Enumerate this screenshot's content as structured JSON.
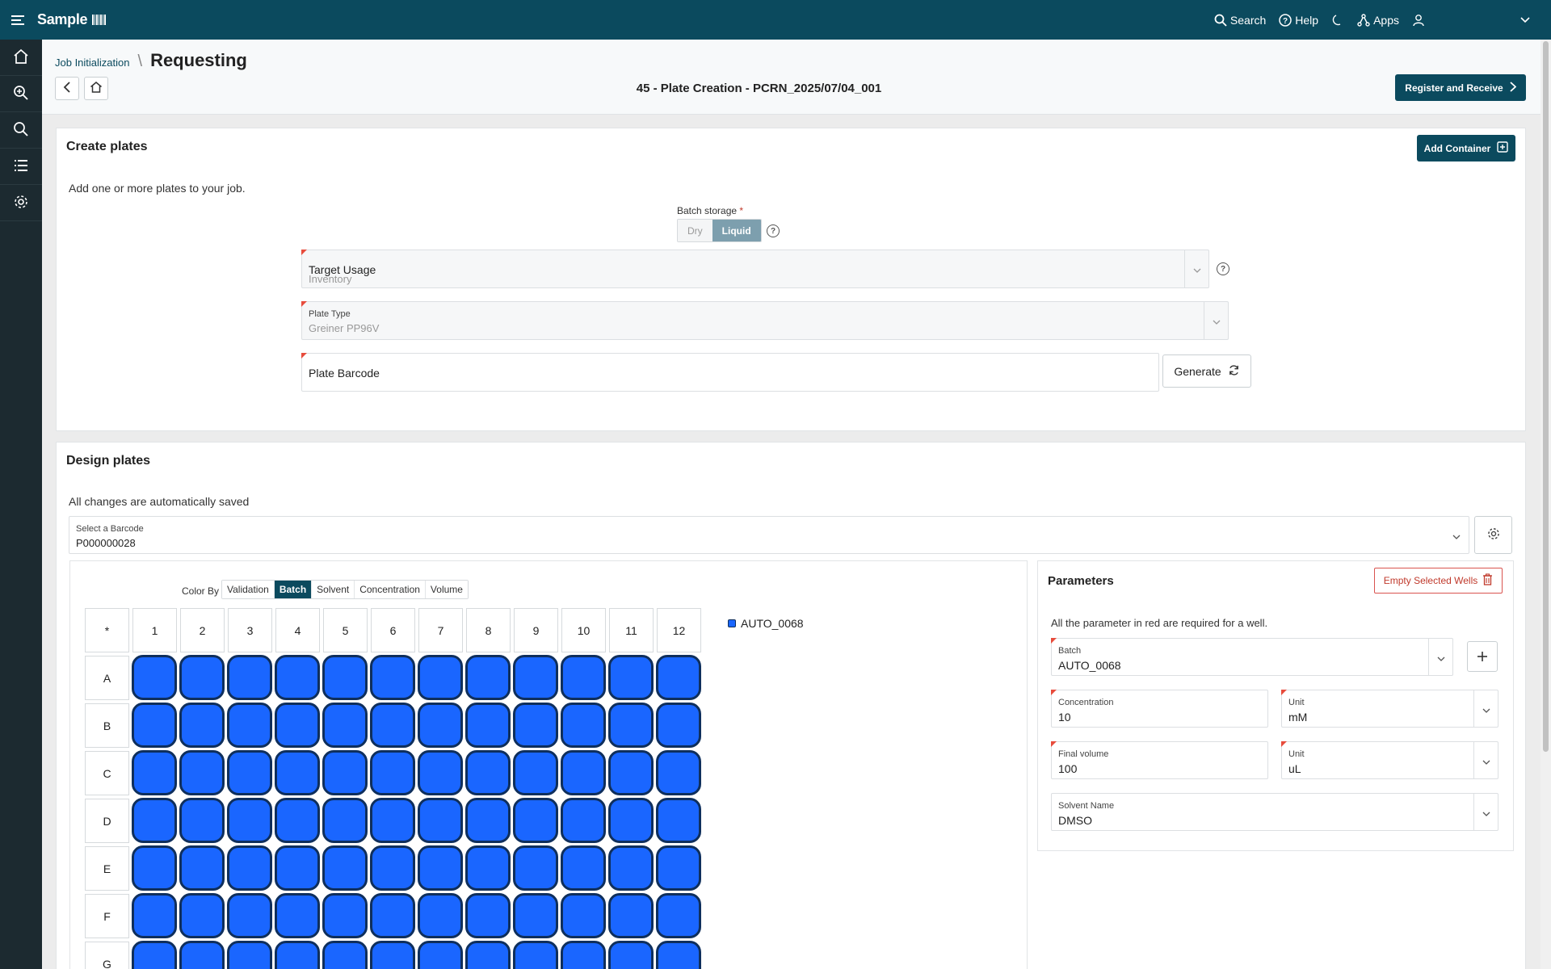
{
  "topbar": {
    "brand": "Sample",
    "search_label": "Search",
    "help_label": "Help",
    "apps_label": "Apps"
  },
  "sidebar": {
    "items": [
      "home-icon",
      "zoom-in-icon",
      "search-icon",
      "list-icon",
      "settings-icon"
    ]
  },
  "header": {
    "breadcrumb_parent": "Job Initialization",
    "breadcrumb_current": "Requesting",
    "job_title": "45 - Plate Creation - PCRN_2025/07/04_001",
    "register_label": "Register and Receive"
  },
  "create_plates": {
    "title": "Create plates",
    "add_container_label": "Add Container",
    "description": "Add one or more plates to your job.",
    "batch_storage_label": "Batch storage",
    "batch_storage_required": "*",
    "storage_options": [
      "Dry",
      "Liquid"
    ],
    "storage_selected": "Liquid",
    "target_usage_label": "Target Usage",
    "target_usage_value": "Inventory",
    "plate_type_label": "Plate Type",
    "plate_type_value": "Greiner PP96V",
    "plate_barcode_label": "Plate Barcode",
    "generate_label": "Generate"
  },
  "design_plates": {
    "title": "Design plates",
    "autosave_note": "All changes are automatically saved",
    "select_barcode_label": "Select a Barcode",
    "select_barcode_value": "P000000028",
    "color_by_label": "Color By",
    "color_by_options": [
      "Validation",
      "Batch",
      "Solvent",
      "Concentration",
      "Volume"
    ],
    "color_by_selected": "Batch",
    "corner_label": "*",
    "columns": [
      "1",
      "2",
      "3",
      "4",
      "5",
      "6",
      "7",
      "8",
      "9",
      "10",
      "11",
      "12"
    ],
    "rows": [
      "A",
      "B",
      "C",
      "D",
      "E",
      "F",
      "G"
    ],
    "legend": [
      {
        "name": "AUTO_0068",
        "color": "#1a66ff"
      }
    ]
  },
  "parameters": {
    "title": "Parameters",
    "empty_wells_label": "Empty Selected Wells",
    "note": "All the parameter in red are required for a well.",
    "batch_label": "Batch",
    "batch_value": "AUTO_0068",
    "concentration_label": "Concentration",
    "concentration_value": "10",
    "conc_unit_label": "Unit",
    "conc_unit_value": "mM",
    "volume_label": "Final volume",
    "volume_value": "100",
    "vol_unit_label": "Unit",
    "vol_unit_value": "uL",
    "solvent_label": "Solvent Name",
    "solvent_value": "DMSO"
  },
  "colors": {
    "brand": "#0b4a5e",
    "well_fill": "#1a66ff",
    "required_flag": "#e74c3c"
  }
}
